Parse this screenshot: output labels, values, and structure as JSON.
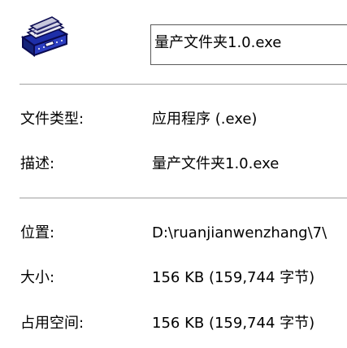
{
  "icon": "file-cabinet-icon",
  "file_name": "量产文件夹1.0.exe",
  "properties": [
    {
      "label": "文件类型:",
      "value": "应用程序 (.exe)"
    },
    {
      "label": "描述:",
      "value": "量产文件夹1.0.exe"
    },
    {
      "label": "位置:",
      "value": "D:\\ruanjianwenzhang\\7\\"
    },
    {
      "label": "大小:",
      "value": "156 KB (159,744 字节)"
    },
    {
      "label": "占用空间:",
      "value": "156 KB (159,744 字节)"
    }
  ]
}
